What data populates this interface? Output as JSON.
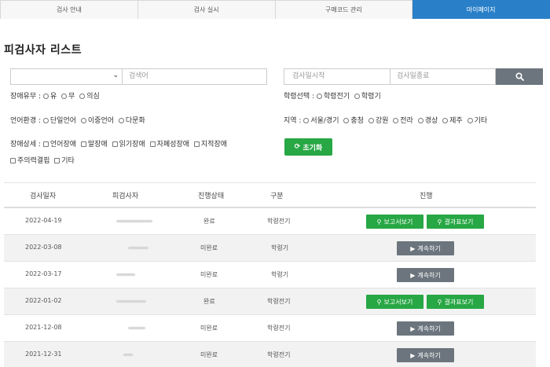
{
  "tabs": [
    {
      "label": "검사 안내",
      "active": false
    },
    {
      "label": "검사 실시",
      "active": false
    },
    {
      "label": "구매코드 관리",
      "active": false
    },
    {
      "label": "마이페이지",
      "active": true
    }
  ],
  "page_title": "피검사자 리스트",
  "search": {
    "select_value": "",
    "keyword_placeholder": "검색어",
    "date_start_placeholder": "검사일시작",
    "date_end_placeholder": "검사일종료"
  },
  "filters": {
    "disability": {
      "label": "장애유무 :",
      "options": [
        "유",
        "무",
        "의심"
      ]
    },
    "school": {
      "label": "학령선택 :",
      "options": [
        "학령전기",
        "학령기"
      ]
    },
    "language": {
      "label": "언어환경 :",
      "options": [
        "단일언어",
        "이중언어",
        "다문화"
      ]
    },
    "region": {
      "label": "지역 :",
      "options": [
        "서울/경기",
        "충청",
        "강원",
        "전라",
        "경상",
        "제주",
        "기타"
      ]
    },
    "detail": {
      "label": "장애상세 :",
      "options_line1": [
        "언어장애",
        "말장애",
        "읽기장애",
        "자폐성장애",
        "지적장애"
      ],
      "options_line2": [
        "주의력결핍",
        "기타"
      ]
    }
  },
  "reset_label": "초기화",
  "table": {
    "headers": [
      "검사일자",
      "피검사자",
      "진행상태",
      "구분",
      "진행"
    ],
    "rows": [
      {
        "date": "2022-04-19",
        "status": "완료",
        "type": "학령전기",
        "actions": [
          "보고서보기",
          "결과표보기"
        ]
      },
      {
        "date": "2022-03-08",
        "status": "미완료",
        "type": "학령기",
        "actions": [
          "계속하기"
        ]
      },
      {
        "date": "2022-03-17",
        "status": "미완료",
        "type": "학령기",
        "actions": [
          "계속하기"
        ]
      },
      {
        "date": "2022-01-02",
        "status": "완료",
        "type": "학령전기",
        "actions": [
          "보고서보기",
          "결과표보기"
        ]
      },
      {
        "date": "2021-12-08",
        "status": "미완료",
        "type": "학령전기",
        "actions": [
          "계속하기"
        ]
      },
      {
        "date": "2021-12-31",
        "status": "미완료",
        "type": "학령전기",
        "actions": [
          "계속하기"
        ]
      }
    ]
  },
  "icons": {
    "search": "search-icon",
    "reset": "refresh-icon",
    "report": "magnifier-icon",
    "continue": "play-icon"
  },
  "colors": {
    "active_tab": "#2a80c8",
    "green": "#28a745",
    "gray": "#6c757d"
  }
}
